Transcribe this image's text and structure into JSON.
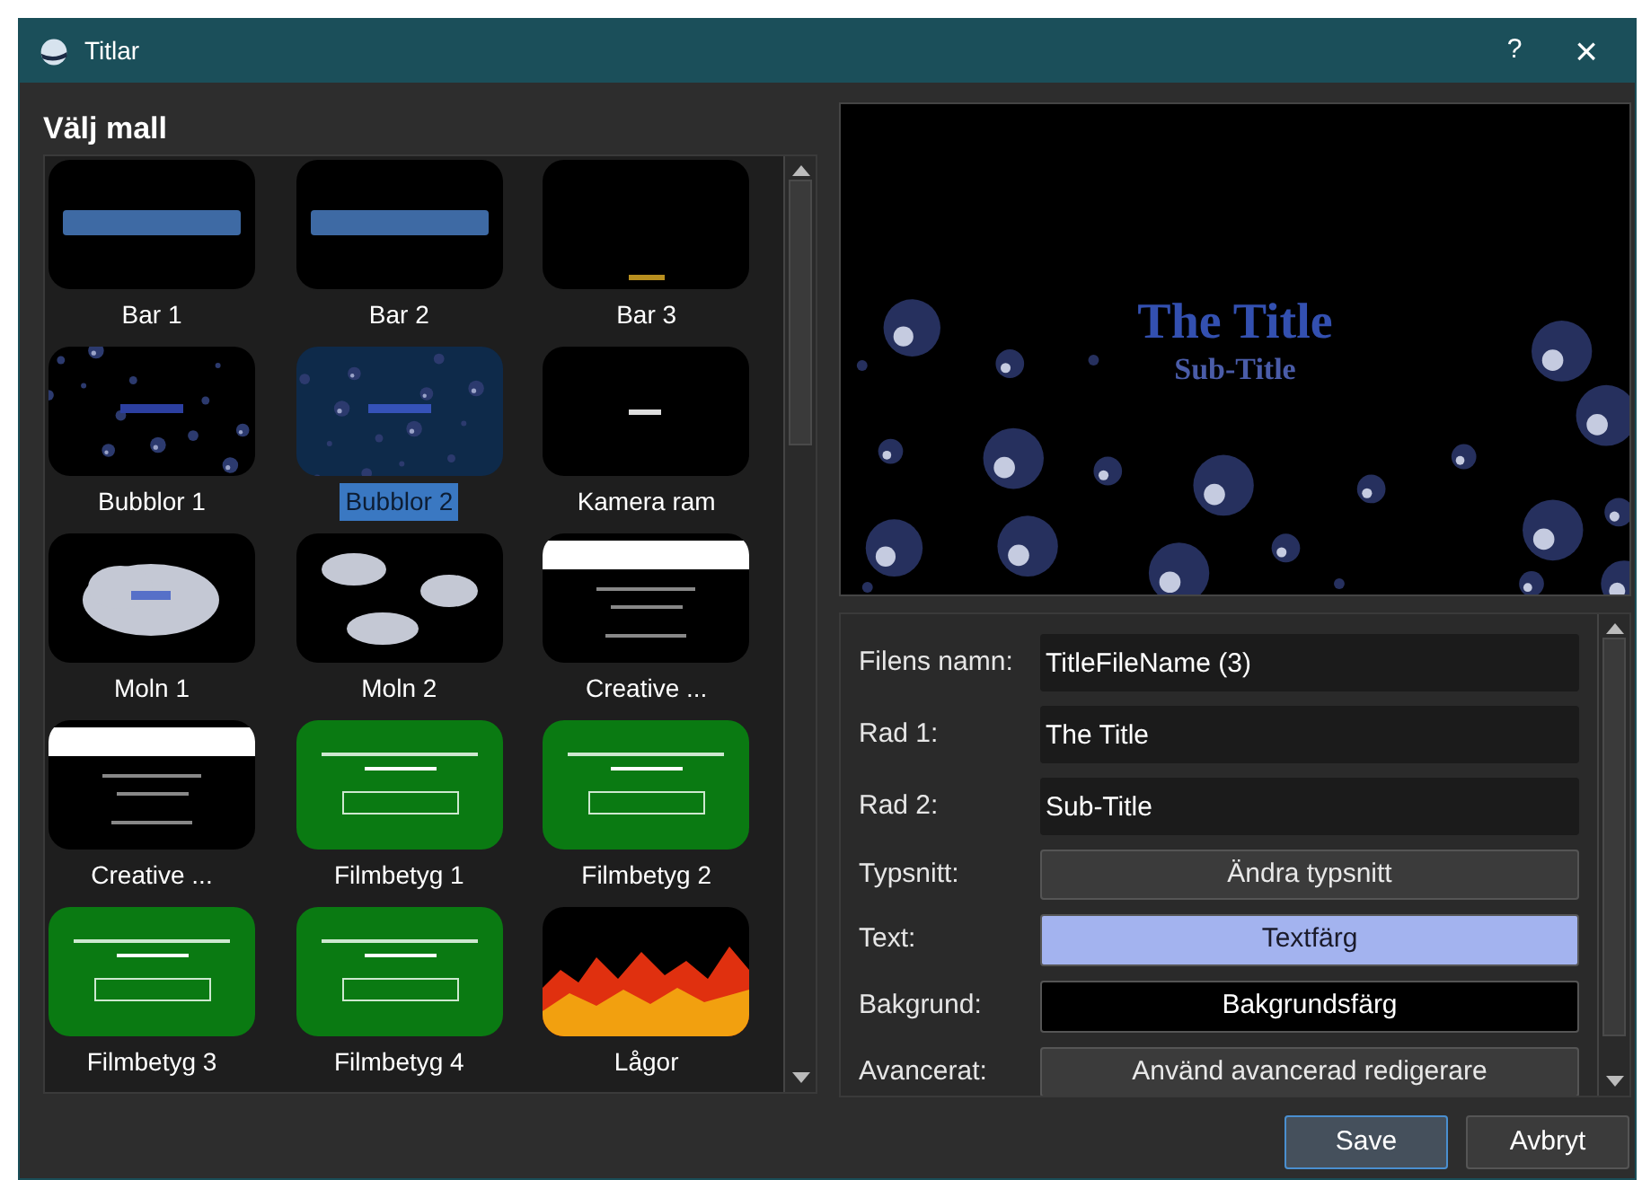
{
  "window": {
    "title": "Titlar",
    "help": "?",
    "close": "×"
  },
  "templates": {
    "heading": "Välj mall",
    "items": [
      {
        "label": "Bar 1",
        "selected": false
      },
      {
        "label": "Bar 2",
        "selected": false
      },
      {
        "label": "Bar 3",
        "selected": false
      },
      {
        "label": "Bubblor 1",
        "selected": false
      },
      {
        "label": "Bubblor 2",
        "selected": true
      },
      {
        "label": "Kamera ram",
        "selected": false
      },
      {
        "label": "Moln 1",
        "selected": false
      },
      {
        "label": "Moln 2",
        "selected": false
      },
      {
        "label": "Creative ...",
        "selected": false
      },
      {
        "label": "Creative ...",
        "selected": false
      },
      {
        "label": "Filmbetyg 1",
        "selected": false
      },
      {
        "label": "Filmbetyg 2",
        "selected": false
      },
      {
        "label": "Filmbetyg 3",
        "selected": false
      },
      {
        "label": "Filmbetyg 4",
        "selected": false
      },
      {
        "label": "Lågor",
        "selected": false
      }
    ]
  },
  "preview": {
    "title": "The Title",
    "subtitle": "Sub-Title"
  },
  "form": [
    {
      "kind": "field",
      "label": "Filens namn:",
      "value": "TitleFileName (3)"
    },
    {
      "kind": "field",
      "label": "Rad 1:",
      "value": "The Title"
    },
    {
      "kind": "field",
      "label": "Rad 2:",
      "value": "Sub-Title"
    },
    {
      "kind": "button",
      "label": "Typsnitt:",
      "button": "Ändra typsnitt"
    },
    {
      "kind": "color",
      "label": "Text:",
      "button": "Textfärg",
      "color": "#a3b3ef"
    },
    {
      "kind": "color",
      "label": "Bakgrund:",
      "button": "Bakgrundsfärg",
      "color": "#000000"
    },
    {
      "kind": "button",
      "label": "Avancerat:",
      "button": "Använd avancerad redigerare"
    }
  ],
  "buttons": [
    {
      "label": "Save",
      "default": true
    },
    {
      "label": "Avbryt",
      "default": false
    }
  ]
}
